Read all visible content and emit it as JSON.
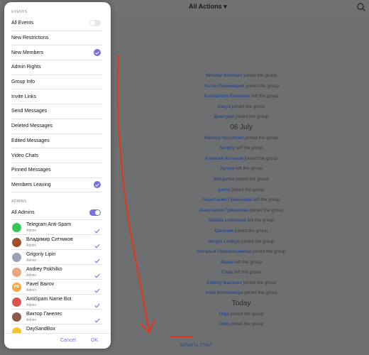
{
  "header": {
    "title": "All Actions ▾"
  },
  "panel": {
    "events_header": "EVENTS",
    "events": [
      {
        "label": "All Events",
        "control": "toggle-off"
      },
      {
        "label": "New Restrictions",
        "control": "none"
      },
      {
        "label": "New Members",
        "control": "check"
      },
      {
        "label": "Admin Rights",
        "control": "none"
      },
      {
        "label": "Group Info",
        "control": "none"
      },
      {
        "label": "Invite Links",
        "control": "none"
      },
      {
        "label": "Send Messages",
        "control": "none"
      },
      {
        "label": "Deleted Messages",
        "control": "none"
      },
      {
        "label": "Edited Messages",
        "control": "none"
      },
      {
        "label": "Video Chats",
        "control": "none"
      },
      {
        "label": "Pinned Messages",
        "control": "none"
      },
      {
        "label": "Members Leaving",
        "control": "check"
      }
    ],
    "admins_header": "ADMINS",
    "all_admins": "All Admins",
    "admins": [
      {
        "name": "Telegram Anti-Spam",
        "role": "Admin",
        "avatar_color": "#34c759",
        "initials": ""
      },
      {
        "name": "Владимир Ситников",
        "role": "Admin",
        "avatar_color": "#a0522d",
        "initials": ""
      },
      {
        "name": "Grigoriy Lipin",
        "role": "Admin",
        "avatar_color": "#9aa3b5",
        "initials": ""
      },
      {
        "name": "Andrey Pokhilko",
        "role": "Admin",
        "avatar_color": "#e8a87c",
        "initials": ""
      },
      {
        "name": "Pavel Bairov",
        "role": "Admin",
        "avatar_color": "#f5a742",
        "initials": "PB"
      },
      {
        "name": "AntiSpam Name Bot",
        "role": "Admin",
        "avatar_color": "#d9534f",
        "initials": ""
      },
      {
        "name": "Виктор Ганелес",
        "role": "Admin",
        "avatar_color": "#8b5a4a",
        "initials": ""
      },
      {
        "name": "DaySandBox",
        "role": "Admin",
        "avatar_color": "#f3c331",
        "initials": ""
      }
    ],
    "cancel": "Cancel",
    "ok": "OK"
  },
  "feed": [
    {
      "type": "event",
      "name": "Nikolay Nikolaev",
      "action": "joined the group"
    },
    {
      "type": "event",
      "name": "Антон Пономарев",
      "action": "joined the group"
    },
    {
      "type": "event",
      "name": "Konstantin Romanov",
      "action": "left the group"
    },
    {
      "type": "event",
      "name": "Darya",
      "action": "joined the group"
    },
    {
      "type": "event",
      "name": "Дмитрий",
      "action": "joined the group"
    },
    {
      "type": "date",
      "text": "06 July"
    },
    {
      "type": "event",
      "name": "Nikolay Gruzhinin",
      "action": "joined the group"
    },
    {
      "type": "event",
      "name": "Sergey",
      "action": "left the group"
    },
    {
      "type": "event",
      "name": "Алексей Котиков",
      "action": "joined the group"
    },
    {
      "type": "event",
      "name": "Артем",
      "action": "left the group"
    },
    {
      "type": "event",
      "name": "Margarita",
      "action": "joined the group"
    },
    {
      "type": "event",
      "name": "pomz",
      "action": "joined the group"
    },
    {
      "type": "event",
      "name": "Анастасия Гуменкова",
      "action": "left the group"
    },
    {
      "type": "event",
      "name": "Анастасия Гуменкова",
      "action": "joined the group"
    },
    {
      "type": "event",
      "name": "Natalia Lebedeva",
      "action": "left the group"
    },
    {
      "type": "event",
      "name": "Евгения",
      "action": "joined the group"
    },
    {
      "type": "event",
      "name": "Sergei Lodkyn",
      "action": "joined the group"
    },
    {
      "type": "event",
      "name": "Наталья Перевощикова",
      "action": "joined the group"
    },
    {
      "type": "event",
      "name": "Маша",
      "action": "left the group"
    },
    {
      "type": "event",
      "name": "Chap",
      "action": "left the group"
    },
    {
      "type": "event",
      "name": "Andrey Baranov",
      "action": "joined the group"
    },
    {
      "type": "event",
      "name": "Yulia Konstskaya",
      "action": "joined the group"
    },
    {
      "type": "date",
      "text": "Today"
    },
    {
      "type": "event",
      "name": "Olga",
      "action": "joined the group"
    },
    {
      "type": "event",
      "name": "Gleb",
      "action": "joined the group"
    }
  ],
  "what_link": "What Is This?",
  "colors": {
    "accent": "#7a6ee0",
    "annotation": "#e8341c"
  }
}
